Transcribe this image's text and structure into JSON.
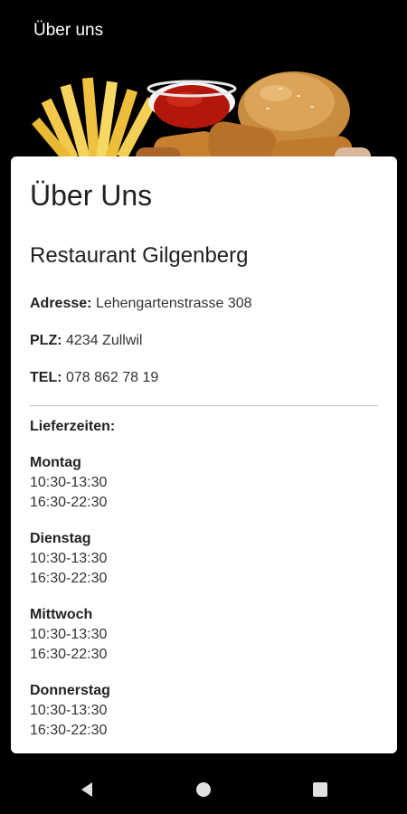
{
  "app_bar": {
    "title": "Über uns"
  },
  "hero": {
    "image": "fast-food-image"
  },
  "card": {
    "page_title": "Über Uns",
    "restaurant_name": "Restaurant Gilgenberg",
    "address": {
      "label": "Adresse:",
      "value": "Lehengartenstrasse 308"
    },
    "zip": {
      "label": "PLZ:",
      "value": "4234 Zullwil"
    },
    "phone": {
      "label": "TEL:",
      "value": "078 862 78 19"
    },
    "delivery_header": "Lieferzeiten:",
    "days": [
      {
        "name": "Montag",
        "slot1": "10:30-13:30",
        "slot2": "16:30-22:30"
      },
      {
        "name": "Dienstag",
        "slot1": "10:30-13:30",
        "slot2": "16:30-22:30"
      },
      {
        "name": "Mittwoch",
        "slot1": "10:30-13:30",
        "slot2": "16:30-22:30"
      },
      {
        "name": "Donnerstag",
        "slot1": "10:30-13:30",
        "slot2": "16:30-22:30"
      }
    ]
  },
  "nav": {
    "back": "back-icon",
    "home": "home-icon",
    "recents": "recents-icon"
  },
  "colors": {
    "background": "#000000",
    "card": "#ffffff",
    "text": "#212121",
    "divider": "#bdbdbd"
  }
}
